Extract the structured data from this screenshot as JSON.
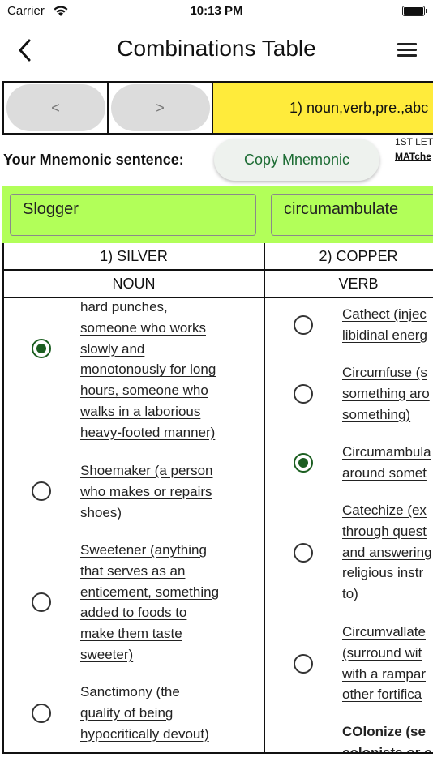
{
  "status_bar": {
    "carrier": "Carrier",
    "time": "10:13 PM"
  },
  "nav": {
    "title": "Combinations Table"
  },
  "pager": {
    "prev_label": "<",
    "next_label": ">",
    "combination_label": "1) noun,verb,pre.,abc"
  },
  "mnemonic": {
    "label": "Your Mnemonic sentence:",
    "copy_button": "Copy Mnemonic",
    "first_letter_label": "1ST LET",
    "matches_link": "MATche"
  },
  "inputs": {
    "word1": "Slogger",
    "word2": "circumambulate"
  },
  "table": {
    "columns": [
      {
        "metal": "1) SILVER",
        "pos": "NOUN"
      },
      {
        "metal": "2) COPPER",
        "pos": "VERB"
      }
    ],
    "col1_options": [
      {
        "text": "hard punches,\nsomeone who works\nslowly and\nmonotonously for long\nhours, someone who\nwalks in a laborious\nheavy-footed manner)",
        "selected": true
      },
      {
        "text": "Shoemaker (a person\nwho makes or repairs\nshoes)",
        "selected": false
      },
      {
        "text": "Sweetener (anything\nthat serves as an\nenticement, something\nadded to foods to\nmake them taste\nsweeter)",
        "selected": false
      },
      {
        "text": "Sanctimony (the\nquality of being\nhypocritically devout)",
        "selected": false
      }
    ],
    "col2_options": [
      {
        "text": "Cathect (injec\nlibidinal energ",
        "selected": false
      },
      {
        "text": "Circumfuse (s\nsomething aro\nsomething)",
        "selected": false
      },
      {
        "text": "Circumambula\naround somet",
        "selected": true
      },
      {
        "text": "Catechize (ex\nthrough quest\nand answering\nreligious instr\nto)",
        "selected": false
      },
      {
        "text": "Circumvallate\n(surround wit\nwith a rampar\nother fortifica",
        "selected": false
      },
      {
        "text": "COlonize (se\ncolonists or c",
        "selected": false
      }
    ]
  }
}
